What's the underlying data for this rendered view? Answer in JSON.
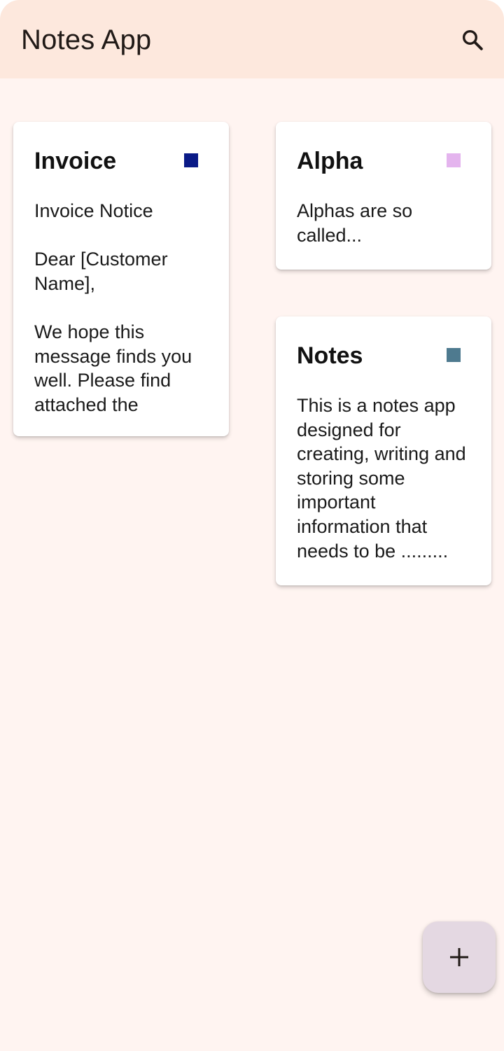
{
  "app_bar": {
    "title": "Notes App",
    "search_icon": "search-icon",
    "background": "#fde8dd"
  },
  "notes": [
    {
      "title": "Invoice",
      "color": "#0a1a87",
      "body": "Invoice Notice\n\nDear [Customer Name],\n\nWe hope this message finds you well. Please find attached the"
    },
    {
      "title": "Alpha",
      "color": "#e4b4ee",
      "body": "Alphas are so called..."
    },
    {
      "title": "Notes",
      "color": "#4e7a8f",
      "body": "This is a notes app designed for creating, writing and storing some important information that needs to be ........."
    }
  ],
  "fab": {
    "icon": "plus-icon",
    "background": "#e4d8e2"
  },
  "colors": {
    "screen_background": "#fff4f1",
    "text": "#1a1a1a"
  }
}
